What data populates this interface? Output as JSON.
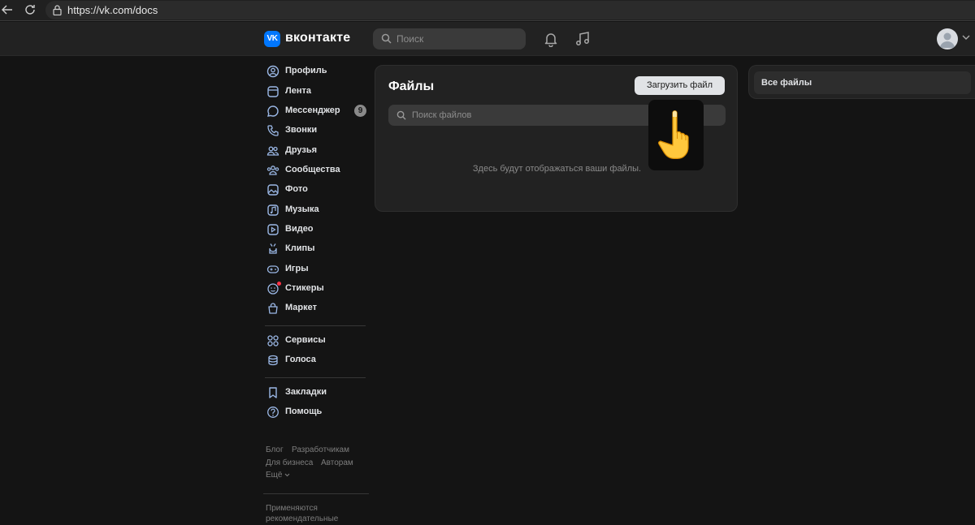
{
  "browser": {
    "url": "https://vk.com/docs"
  },
  "header": {
    "logo_text": "вконтакте",
    "search_placeholder": "Поиск"
  },
  "sidebar": {
    "items": [
      {
        "label": "Профиль",
        "icon": "profile-icon"
      },
      {
        "label": "Лента",
        "icon": "feed-icon"
      },
      {
        "label": "Мессенджер",
        "icon": "messenger-icon",
        "badge": "9"
      },
      {
        "label": "Звонки",
        "icon": "phone-icon"
      },
      {
        "label": "Друзья",
        "icon": "friends-icon"
      },
      {
        "label": "Сообщества",
        "icon": "communities-icon"
      },
      {
        "label": "Фото",
        "icon": "photo-icon"
      },
      {
        "label": "Музыка",
        "icon": "music-icon"
      },
      {
        "label": "Видео",
        "icon": "video-icon"
      },
      {
        "label": "Клипы",
        "icon": "clips-icon"
      },
      {
        "label": "Игры",
        "icon": "games-icon"
      },
      {
        "label": "Стикеры",
        "icon": "stickers-icon"
      },
      {
        "label": "Маркет",
        "icon": "market-icon"
      }
    ],
    "group2": [
      {
        "label": "Сервисы",
        "icon": "services-icon"
      },
      {
        "label": "Голоса",
        "icon": "votes-icon"
      }
    ],
    "group3": [
      {
        "label": "Закладки",
        "icon": "bookmark-icon"
      },
      {
        "label": "Помощь",
        "icon": "help-icon"
      }
    ],
    "footer": {
      "blog": "Блог",
      "developers": "Разработчикам",
      "business": "Для бизнеса",
      "authors": "Авторам",
      "more": "Ещё",
      "notice_line1": "Применяются",
      "notice_line2": "рекомендательные"
    }
  },
  "main": {
    "title": "Файлы",
    "upload_button": "Загрузить файл",
    "search_placeholder": "Поиск файлов",
    "empty_message": "Здесь будут отображаться ваши файлы."
  },
  "right_panel": {
    "items": [
      {
        "label": "Все файлы",
        "selected": true
      }
    ]
  },
  "colors": {
    "background": "#141414",
    "panel": "#222222",
    "accent": "#0077ff",
    "notification_dot": "#ff3347"
  }
}
